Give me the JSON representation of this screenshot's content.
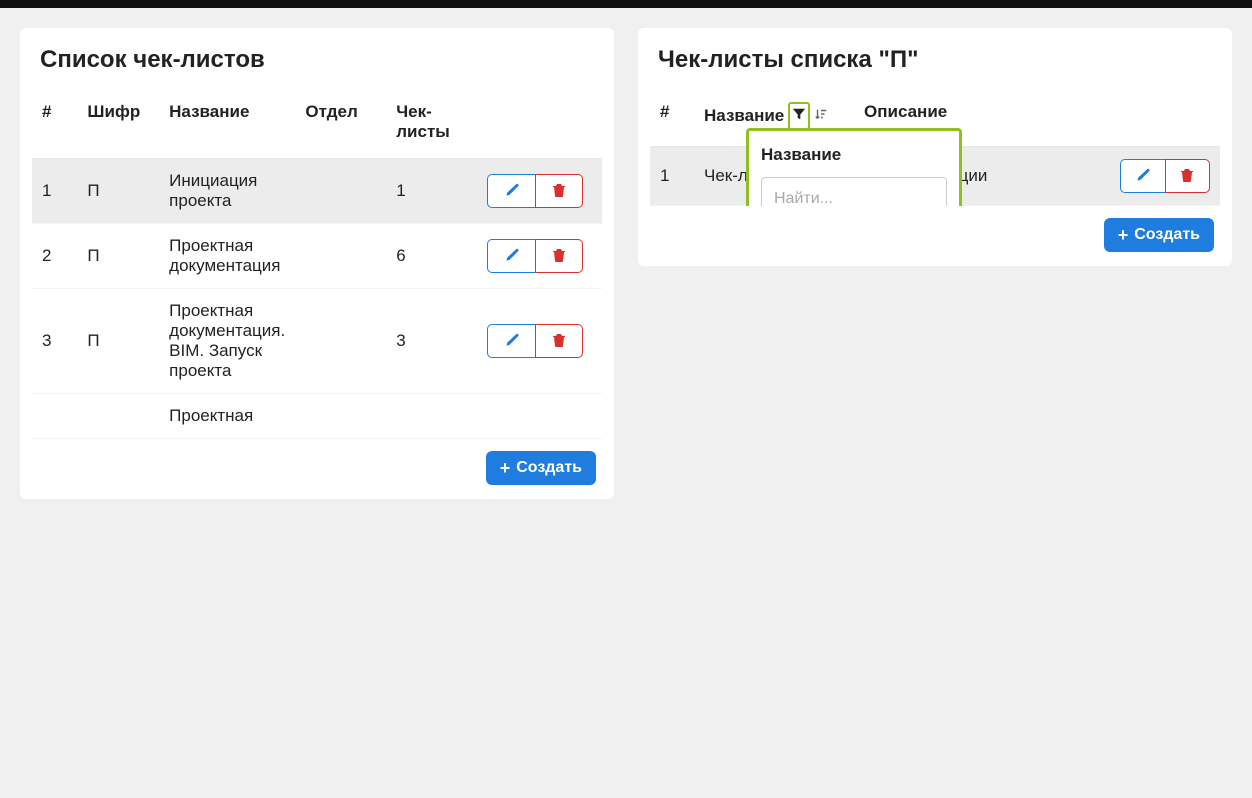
{
  "left": {
    "title": "Список чек-листов",
    "cols": {
      "num": "#",
      "code": "Шифр",
      "name": "Название",
      "dept": "Отдел",
      "checklists": "Чек-листы"
    },
    "rows": [
      {
        "num": "1",
        "code": "П",
        "name": "Инициация проекта",
        "dept": "",
        "checklists": "1"
      },
      {
        "num": "2",
        "code": "П",
        "name": "Проектная документация",
        "dept": "",
        "checklists": "6"
      },
      {
        "num": "3",
        "code": "П",
        "name": "Проектная документация. BIM. Запуск проекта",
        "dept": "",
        "checklists": "3"
      },
      {
        "num": "",
        "code": "",
        "name": "Проектная",
        "dept": "",
        "checklists": ""
      }
    ],
    "create": "Создать"
  },
  "right": {
    "title": "Чек-листы списка \"П\"",
    "cols": {
      "num": "#",
      "name": "Название",
      "desc": "Описание"
    },
    "rows": [
      {
        "num": "1",
        "name": "Чек-лист",
        "desc": "я РП на диации"
      }
    ],
    "create": "Создать",
    "filter": {
      "label": "Название",
      "placeholder": "Найти..."
    }
  }
}
